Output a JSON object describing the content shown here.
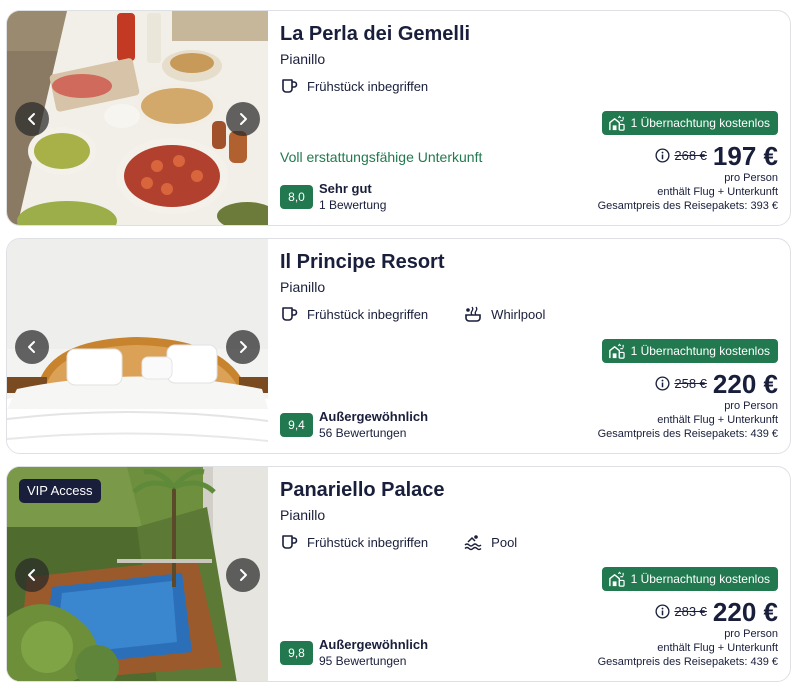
{
  "hotels": [
    {
      "name": "La Perla dei Gemelli",
      "location": "Pianillo",
      "amenities": [
        {
          "icon": "coffee-cup-icon",
          "label": "Frühstück inbegriffen"
        }
      ],
      "refund": "Voll erstattungsfähige Unterkunft",
      "badge": "1 Übernachtung kostenlos",
      "old_price": "268 €",
      "new_price": "197 €",
      "per_person": "pro Person",
      "includes": "enthält Flug + Unterkunft",
      "total": "Gesamtpreis des Reisepakets: 393 €",
      "score": "8,0",
      "rating_label": "Sehr gut",
      "rating_count": "1 Bewertung",
      "vip": ""
    },
    {
      "name": "Il Principe Resort",
      "location": "Pianillo",
      "amenities": [
        {
          "icon": "coffee-cup-icon",
          "label": "Frühstück inbegriffen"
        },
        {
          "icon": "hot-tub-icon",
          "label": "Whirlpool"
        }
      ],
      "refund": "",
      "badge": "1 Übernachtung kostenlos",
      "old_price": "258 €",
      "new_price": "220 €",
      "per_person": "pro Person",
      "includes": "enthält Flug + Unterkunft",
      "total": "Gesamtpreis des Reisepakets: 439 €",
      "score": "9,4",
      "rating_label": "Außergewöhnlich",
      "rating_count": "56 Bewertungen",
      "vip": ""
    },
    {
      "name": "Panariello Palace",
      "location": "Pianillo",
      "amenities": [
        {
          "icon": "coffee-cup-icon",
          "label": "Frühstück inbegriffen"
        },
        {
          "icon": "pool-icon",
          "label": "Pool"
        }
      ],
      "refund": "",
      "badge": "1 Übernachtung kostenlos",
      "old_price": "283 €",
      "new_price": "220 €",
      "per_person": "pro Person",
      "includes": "enthält Flug + Unterkunft",
      "total": "Gesamtpreis des Reisepakets: 439 €",
      "score": "9,8",
      "rating_label": "Außergewöhnlich",
      "rating_count": "95 Bewertungen",
      "vip": "VIP Access"
    }
  ],
  "colors": {
    "brand_green": "#227950",
    "text_dark": "#191e3b",
    "border": "#dfe0e4"
  }
}
